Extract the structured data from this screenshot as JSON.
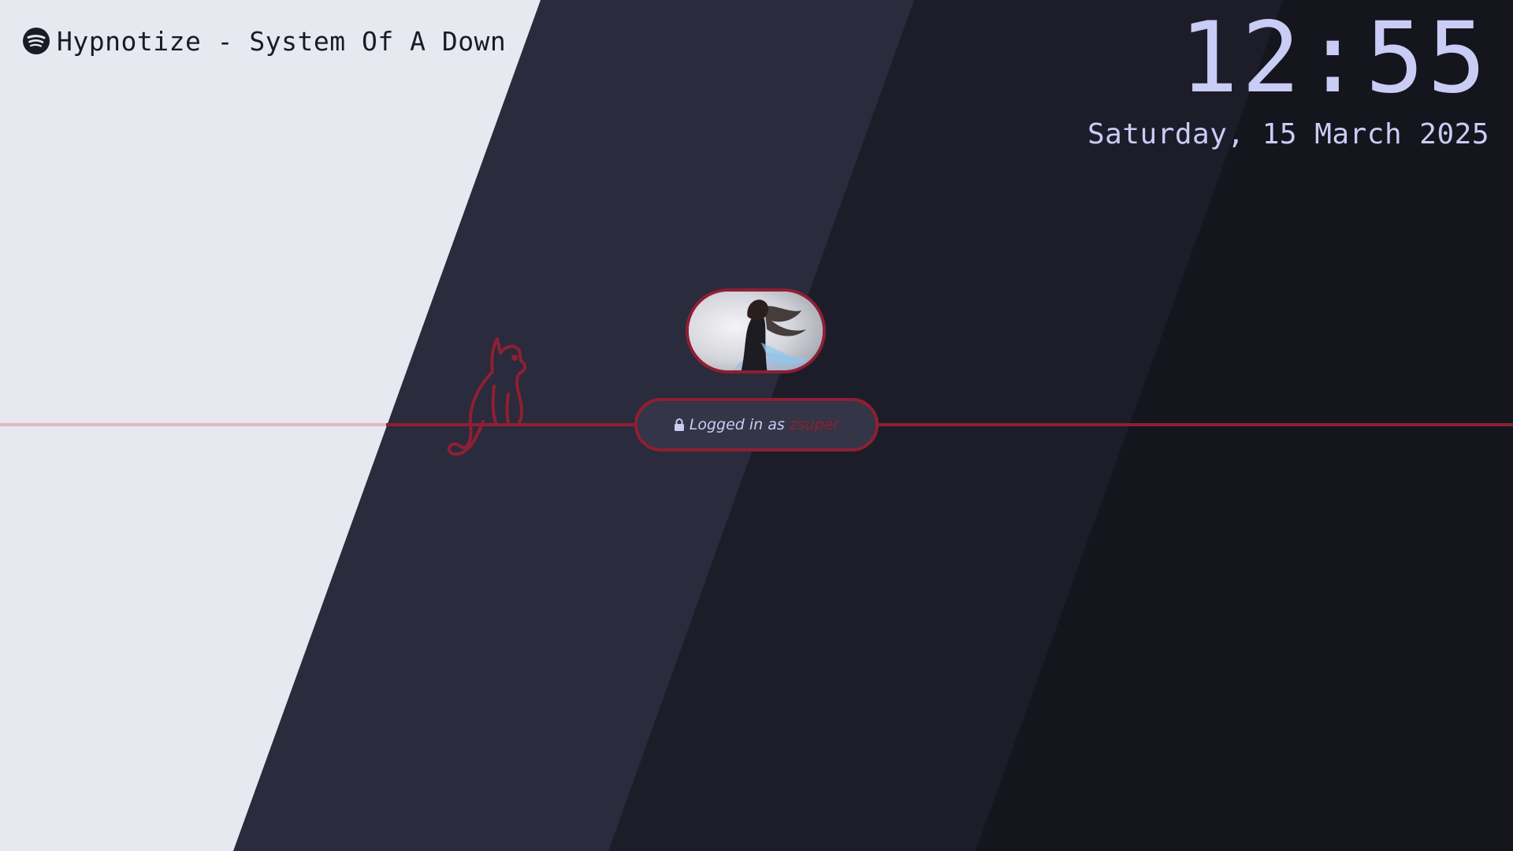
{
  "media": {
    "icon": "spotify-icon",
    "now_playing": "Hypnotize - System Of A Down"
  },
  "clock": {
    "time": "12:55",
    "date": "Saturday, 15 March 2025"
  },
  "login": {
    "icon": "lock-icon",
    "prefix": "Logged in as",
    "username": "zsuper"
  },
  "colors": {
    "accent": "#8f1f33",
    "text_light": "#c9cdf5",
    "text_dark": "#1a1b26",
    "bg_light": "#e6e9f0",
    "bg_slate": "#2a2b3c",
    "bg_dark": "#1d1d2a",
    "pill_bg": "#343547"
  }
}
